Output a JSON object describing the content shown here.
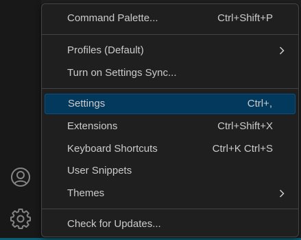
{
  "colors": {
    "menu_background": "#1f1f1f",
    "selected_background": "#04395e",
    "text": "#cccccc",
    "separator": "#454545",
    "activity_bar": "#181818",
    "status_strip": "#0b5d73"
  },
  "activity_bar": {
    "icons": [
      "account-icon",
      "gear-icon"
    ]
  },
  "menu": {
    "items": [
      {
        "label": "Command Palette...",
        "shortcut": "Ctrl+Shift+P"
      },
      {
        "label": "Profiles (Default)",
        "shortcut": "",
        "submenu": true
      },
      {
        "label": "Turn on Settings Sync...",
        "shortcut": ""
      },
      {
        "label": "Settings",
        "shortcut": "Ctrl+,",
        "selected": true
      },
      {
        "label": "Extensions",
        "shortcut": "Ctrl+Shift+X"
      },
      {
        "label": "Keyboard Shortcuts",
        "shortcut": "Ctrl+K Ctrl+S"
      },
      {
        "label": "User Snippets",
        "shortcut": ""
      },
      {
        "label": "Themes",
        "shortcut": "",
        "submenu": true
      },
      {
        "label": "Check for Updates...",
        "shortcut": ""
      }
    ]
  }
}
